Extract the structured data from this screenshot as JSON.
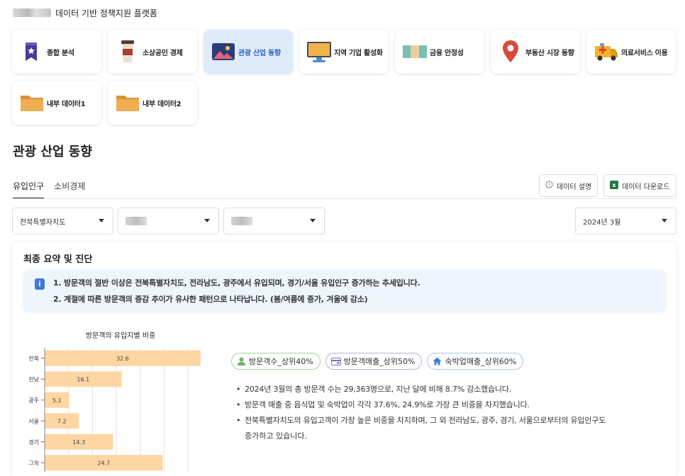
{
  "header": {
    "title": "데이터 기반 정책지원 플랫폼"
  },
  "categories": [
    {
      "label": "종합 분석",
      "icon": "book-icon"
    },
    {
      "label": "소상공인 경제",
      "icon": "coffee-cup-icon"
    },
    {
      "label": "관광 산업 동향",
      "icon": "landscape-icon",
      "active": true
    },
    {
      "label": "지역 기업 활성화",
      "icon": "monitor-icon"
    },
    {
      "label": "금융 안정성",
      "icon": "money-icon"
    },
    {
      "label": "부동산 시장 동향",
      "icon": "location-pin-icon"
    },
    {
      "label": "의료서비스 이용",
      "icon": "ambulance-icon"
    },
    {
      "label": "내부 데이터1",
      "icon": "folder-icon"
    },
    {
      "label": "내부 데이터2",
      "icon": "folder-icon"
    }
  ],
  "page": {
    "title": "관광 산업 동향"
  },
  "tabs": [
    {
      "label": "유입인구",
      "active": true
    },
    {
      "label": "소비경제"
    }
  ],
  "actions": {
    "description": "데이터 설명",
    "download": "데이터 다운로드"
  },
  "filters": {
    "region": "전북특별자치도",
    "period": "2024년 3월"
  },
  "summary": {
    "title": "최종 요약 및 진단",
    "lines": [
      "1. 방문객의 절반 이상은 전북특별자치도, 전라남도, 광주에서 유입되며, 경기/서울 유입인구 증가하는 추세입니다.",
      "2. 계절에 따른 방문객의 증감 추이가 유사한 패턴으로 나타납니다. (봄/여름에 증가, 겨울에 감소)"
    ]
  },
  "chart_data": {
    "type": "bar",
    "orientation": "horizontal",
    "title": "방문객의 유입지별 비중",
    "categories": [
      "전북",
      "전남",
      "광주",
      "서울",
      "경기",
      "그외"
    ],
    "values": [
      32.6,
      16.1,
      5.1,
      7.2,
      14.3,
      24.7
    ],
    "xlim": [
      0,
      35
    ],
    "grid": true,
    "bar_color": "#fdd6a4"
  },
  "tags": [
    {
      "label": "방문객수_상위40%",
      "icon": "person-icon",
      "color": "#6db35a"
    },
    {
      "label": "방문객매출_상위50%",
      "icon": "card-icon",
      "color": "#7d72b8"
    },
    {
      "label": "숙박업매출_상위60%",
      "icon": "house-icon",
      "color": "#3d7fd6"
    }
  ],
  "bullets": [
    "2024년 3월의 총 방문객 수는 29,363명으로, 지난 달에 비해 8.7% 감소했습니다.",
    "방문객 매출 중 음식업 및 숙박업이 각각 37.6%, 24.9%로 가장 큰 비중을 차지했습니다.",
    "전북특별자치도의 유입고객이 가장 높은 비중을 차지하며, 그 외 전라남도, 광주, 경기, 서울으로부터의 유입인구도",
    "증가하고 있습니다."
  ]
}
